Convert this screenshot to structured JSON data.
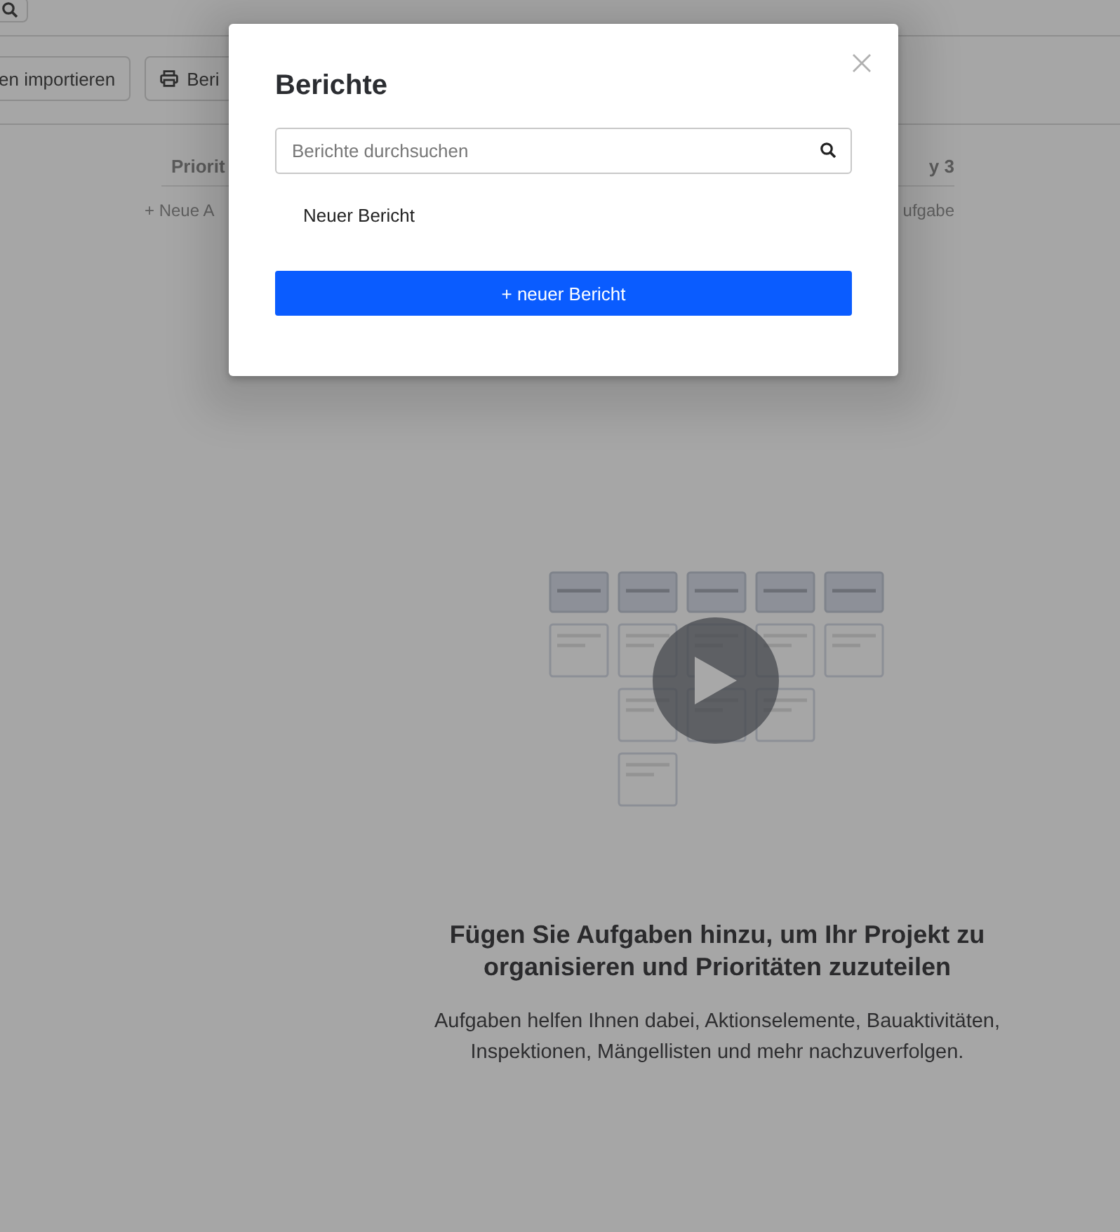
{
  "background": {
    "toolbar_buttons": [
      {
        "label": "en importieren",
        "kind": "text"
      },
      {
        "label": "Beri",
        "kind": "print"
      }
    ],
    "columns": [
      {
        "header": "Priorit",
        "add_label": "+ Neue A"
      },
      {
        "header": "y 3",
        "add_label": "ufgabe"
      }
    ],
    "empty_state": {
      "heading": "Fügen Sie Aufgaben hinzu, um Ihr Projekt zu organisieren und Prioritäten zuzuteilen",
      "text": "Aufgaben helfen Ihnen dabei, Aktionselemente, Bauaktivitäten, Inspektionen, Mängellisten und mehr nachzuverfolgen."
    }
  },
  "modal": {
    "title": "Berichte",
    "search": {
      "placeholder": "Berichte durchsuchen"
    },
    "reports": [
      "Neuer Bericht"
    ],
    "new_button": "+ neuer Bericht"
  }
}
